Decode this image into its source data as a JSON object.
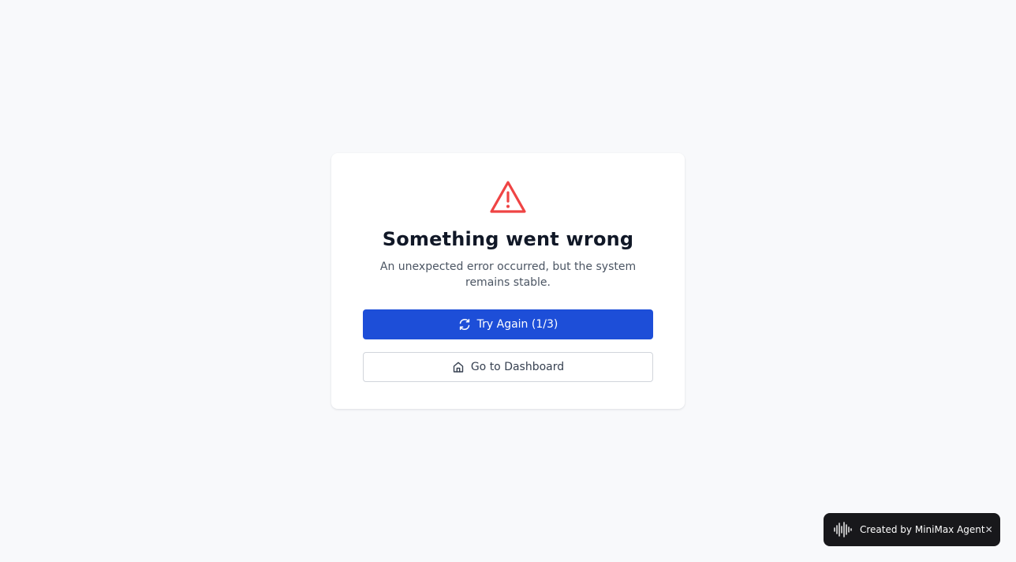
{
  "error_card": {
    "icon": "warning-triangle-icon",
    "title": "Something went wrong",
    "message": "An unexpected error occurred, but the system remains stable.",
    "retry_button": {
      "icon": "refresh-icon",
      "label": "Try Again (1/3)"
    },
    "dashboard_button": {
      "icon": "home-icon",
      "label": "Go to Dashboard"
    }
  },
  "badge": {
    "icon": "waveform-logo-icon",
    "text": "Created by MiniMax Agent",
    "close_icon": "close-icon",
    "close_glyph": "✕"
  },
  "colors": {
    "background": "#f8f9fb",
    "accent": "#1d4ed8",
    "danger": "#ef4444",
    "badge_bg": "#18181b"
  }
}
